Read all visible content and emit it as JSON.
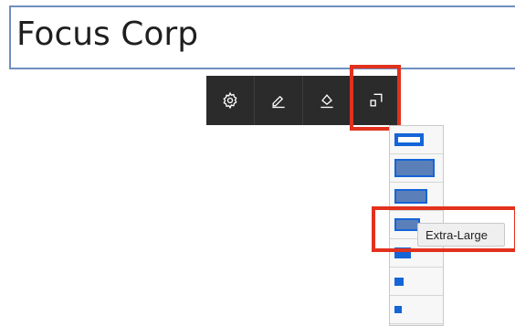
{
  "title": {
    "text": "Focus Corp"
  },
  "toolbar": {
    "buttons": [
      {
        "name": "settings",
        "icon": "gear-icon"
      },
      {
        "name": "edit",
        "icon": "pencil-icon"
      },
      {
        "name": "fill",
        "icon": "paint-bucket-icon"
      },
      {
        "name": "size",
        "icon": "resize-icon"
      }
    ]
  },
  "size_menu": {
    "hovered_label": "Extra-Large"
  },
  "colors": {
    "toolbar_bg": "#2b2b2b",
    "accent": "#1565d8",
    "highlight": "#e2311d"
  }
}
